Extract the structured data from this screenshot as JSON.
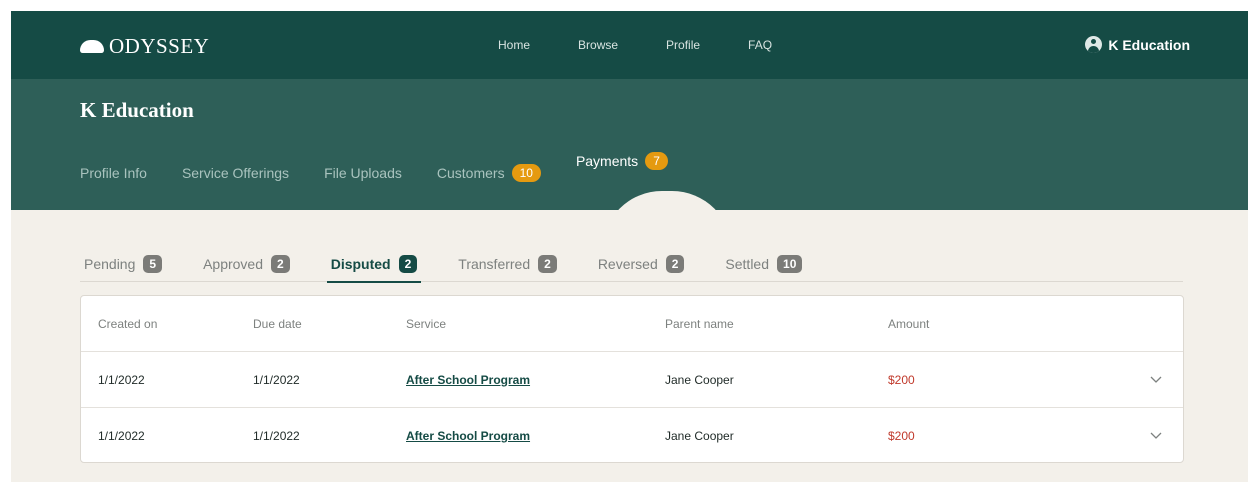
{
  "brand": {
    "name": "ODYSSEY",
    "logo_icon": "sun-dome-icon"
  },
  "nav": {
    "links": [
      "Home",
      "Browse",
      "Profile",
      "FAQ"
    ]
  },
  "user": {
    "name": "K Education",
    "icon": "user-avatar-icon"
  },
  "header": {
    "title": "K Education"
  },
  "main_tabs": [
    {
      "label": "Profile Info"
    },
    {
      "label": "Service Offerings"
    },
    {
      "label": "File Uploads"
    },
    {
      "label": "Customers",
      "badge": "10"
    },
    {
      "label": "Payments",
      "badge": "7",
      "active": true
    }
  ],
  "sub_tabs": [
    {
      "label": "Pending",
      "count": "5"
    },
    {
      "label": "Approved",
      "count": "2"
    },
    {
      "label": "Disputed",
      "count": "2",
      "active": true
    },
    {
      "label": "Transferred",
      "count": "2"
    },
    {
      "label": "Reversed",
      "count": "2"
    },
    {
      "label": "Settled",
      "count": "10"
    }
  ],
  "table": {
    "columns": [
      "Created on",
      "Due date",
      "Service",
      "Parent name",
      "Amount"
    ],
    "rows": [
      {
        "created": "1/1/2022",
        "due": "1/1/2022",
        "service": "After School Program",
        "parent": "Jane Cooper",
        "amount": "$200"
      },
      {
        "created": "1/1/2022",
        "due": "1/1/2022",
        "service": "After School Program",
        "parent": "Jane Cooper",
        "amount": "$200"
      }
    ]
  },
  "colors": {
    "primary": "#154b45",
    "band": "#2e5f58",
    "badge": "#e59a10",
    "amount": "#c0392b",
    "background": "#f3f0ea"
  }
}
